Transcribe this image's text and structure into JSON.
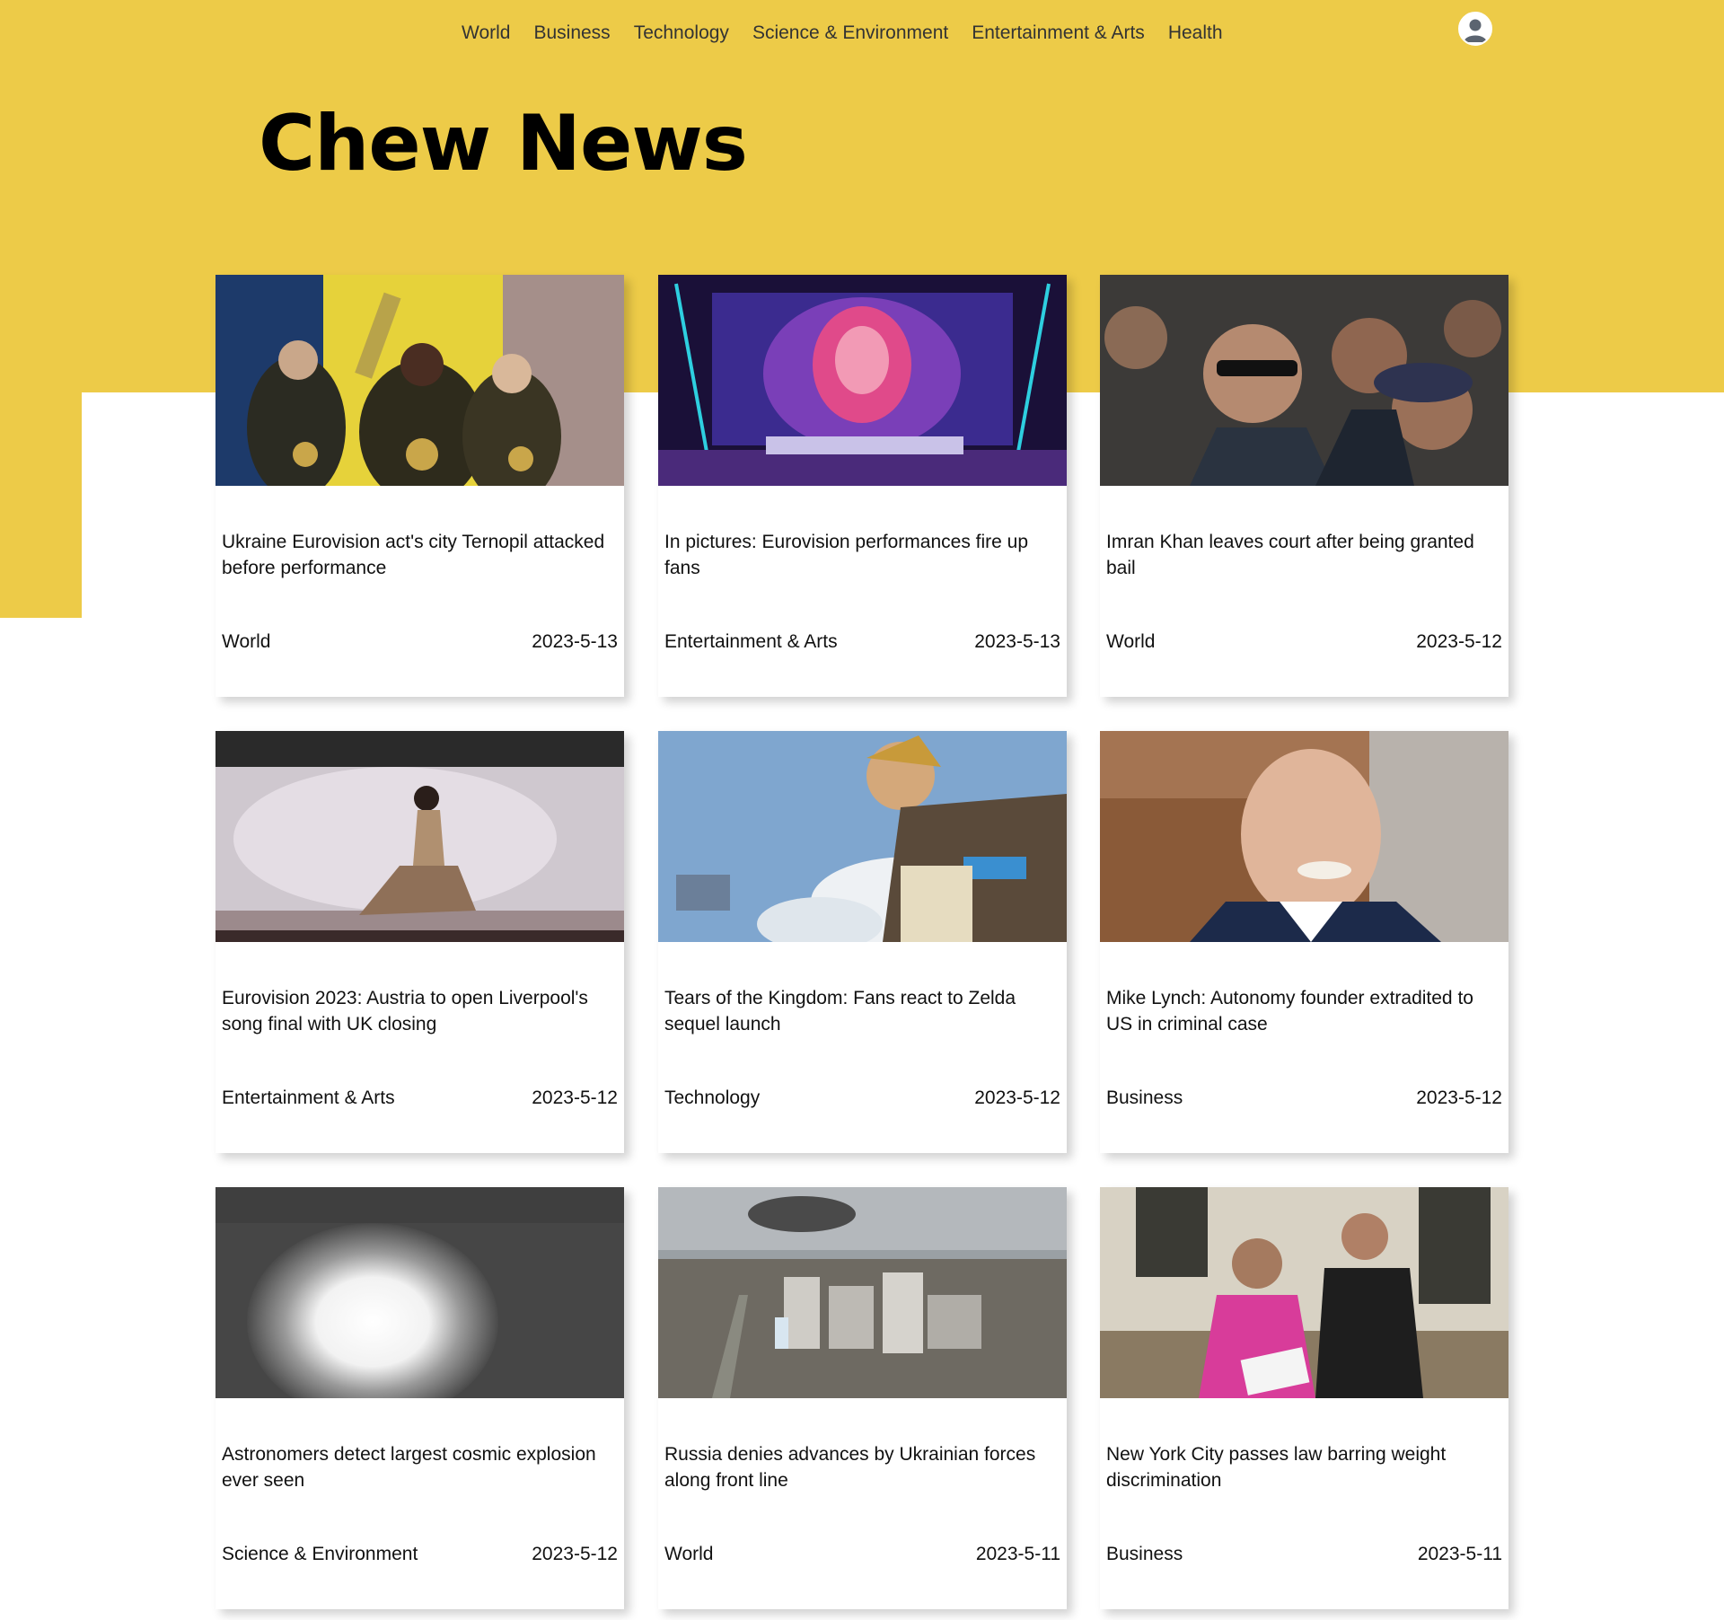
{
  "nav": {
    "items": [
      {
        "label": "World"
      },
      {
        "label": "Business"
      },
      {
        "label": "Technology"
      },
      {
        "label": "Science & Environment"
      },
      {
        "label": "Entertainment & Arts"
      },
      {
        "label": "Health"
      }
    ],
    "user_icon": "user-avatar-icon"
  },
  "header": {
    "title": "Chew News"
  },
  "colors": {
    "brand_yellow": "#edcb48",
    "text": "#111111"
  },
  "articles": [
    {
      "title": "Ukraine Eurovision act's city Ternopil attacked before performance",
      "category": "World",
      "date": "2023-5-13",
      "image": "eurovision-performers-photo"
    },
    {
      "title": "In pictures: Eurovision performances fire up fans",
      "category": "Entertainment & Arts",
      "date": "2023-5-13",
      "image": "eurovision-stage-photo"
    },
    {
      "title": "Imran Khan leaves court after being granted bail",
      "category": "World",
      "date": "2023-5-12",
      "image": "imran-khan-crowd-photo"
    },
    {
      "title": "Eurovision 2023: Austria to open Liverpool's song final with UK closing",
      "category": "Entertainment & Arts",
      "date": "2023-5-12",
      "image": "singer-on-stage-photo"
    },
    {
      "title": "Tears of the Kingdom: Fans react to Zelda sequel launch",
      "category": "Technology",
      "date": "2023-5-12",
      "image": "zelda-game-art"
    },
    {
      "title": "Mike Lynch: Autonomy founder extradited to US in criminal case",
      "category": "Business",
      "date": "2023-5-12",
      "image": "mike-lynch-portrait-photo"
    },
    {
      "title": "Astronomers detect largest cosmic explosion ever seen",
      "category": "Science & Environment",
      "date": "2023-5-12",
      "image": "cosmic-explosion-image"
    },
    {
      "title": "Russia denies advances by Ukrainian forces along front line",
      "category": "World",
      "date": "2023-5-11",
      "image": "war-damaged-city-photo"
    },
    {
      "title": "New York City passes law barring weight discrimination",
      "category": "Business",
      "date": "2023-5-11",
      "image": "activists-city-hall-photo"
    }
  ]
}
